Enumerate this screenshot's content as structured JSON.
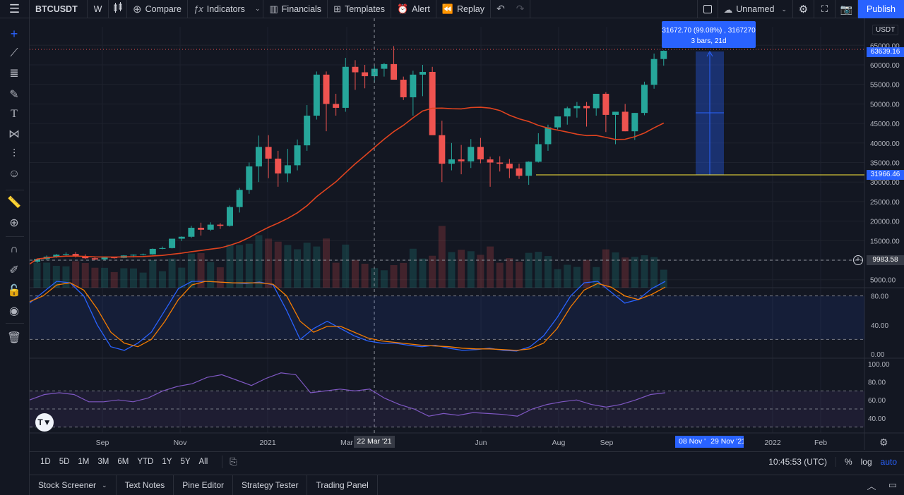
{
  "toolbar": {
    "symbol": "BTCUSDT",
    "interval": "W",
    "compare": "Compare",
    "indicators": "Indicators",
    "financials": "Financials",
    "templates": "Templates",
    "alert": "Alert",
    "replay": "Replay",
    "layout_name": "Unnamed",
    "publish": "Publish"
  },
  "price_axis": {
    "currency": "USDT",
    "ticks": [
      "65000.00",
      "60000.00",
      "55000.00",
      "50000.00",
      "45000.00",
      "40000.00",
      "35000.00",
      "30000.00",
      "25000.00",
      "20000.00",
      "15000.00",
      "10000.00",
      "5000.00"
    ],
    "last_price": "63639.16",
    "horizontal_line_price": "31966.46",
    "crosshair_price": "9983.58"
  },
  "measure_tooltip": {
    "line1": "31672.70 (99.08%) , 3167270",
    "line2": "3 bars, 21d"
  },
  "oscillator1_ticks": [
    "80.00",
    "40.00",
    "0.00"
  ],
  "oscillator2_ticks": [
    "100.00",
    "80.00",
    "60.00",
    "40.00"
  ],
  "time_axis": {
    "labels": [
      "Sep",
      "Nov",
      "2021",
      "Mar",
      "Jun",
      "Aug",
      "Sep",
      "2022",
      "Feb"
    ],
    "crosshair_date": "22 Mar '21",
    "range_start": "08 Nov '",
    "range_end": "29 Nov '21"
  },
  "timeframes": [
    "1D",
    "5D",
    "1M",
    "3M",
    "6M",
    "YTD",
    "1Y",
    "5Y",
    "All"
  ],
  "clock": "10:45:53 (UTC)",
  "scale_options": [
    "%",
    "log",
    "auto"
  ],
  "bottom_tabs": [
    "Stock Screener",
    "Text Notes",
    "Pine Editor",
    "Strategy Tester",
    "Trading Panel"
  ],
  "colors": {
    "up": "#26a69a",
    "down": "#ef5350",
    "ma": "#e0431f",
    "stoch_k": "#2962ff",
    "stoch_d": "#f57c00",
    "rsi": "#7e57c2",
    "accent": "#2962ff",
    "hline": "#ffeb3b"
  },
  "chart_data": {
    "type": "candlestick",
    "candles": [
      {
        "o": 9600,
        "h": 10400,
        "l": 9300,
        "c": 10300
      },
      {
        "o": 10300,
        "h": 11200,
        "l": 10000,
        "c": 10900
      },
      {
        "o": 10900,
        "h": 11600,
        "l": 10600,
        "c": 11400
      },
      {
        "o": 11400,
        "h": 12000,
        "l": 11000,
        "c": 11600
      },
      {
        "o": 11600,
        "h": 12100,
        "l": 10700,
        "c": 11000
      },
      {
        "o": 11000,
        "h": 11500,
        "l": 10300,
        "c": 10500
      },
      {
        "o": 10500,
        "h": 10800,
        "l": 10000,
        "c": 10200
      },
      {
        "o": 10200,
        "h": 10900,
        "l": 10100,
        "c": 10700
      },
      {
        "o": 10700,
        "h": 10900,
        "l": 10400,
        "c": 10600
      },
      {
        "o": 10600,
        "h": 11300,
        "l": 10500,
        "c": 11200
      },
      {
        "o": 11200,
        "h": 11500,
        "l": 10700,
        "c": 11400
      },
      {
        "o": 11400,
        "h": 11700,
        "l": 11200,
        "c": 11500
      },
      {
        "o": 11500,
        "h": 13000,
        "l": 11400,
        "c": 12900
      },
      {
        "o": 12900,
        "h": 13500,
        "l": 12800,
        "c": 13100
      },
      {
        "o": 13100,
        "h": 15000,
        "l": 13000,
        "c": 15500
      },
      {
        "o": 15500,
        "h": 16100,
        "l": 14900,
        "c": 16000
      },
      {
        "o": 16000,
        "h": 18800,
        "l": 15700,
        "c": 18300
      },
      {
        "o": 18300,
        "h": 19600,
        "l": 16300,
        "c": 17800
      },
      {
        "o": 17800,
        "h": 19700,
        "l": 17500,
        "c": 19100
      },
      {
        "o": 19100,
        "h": 19500,
        "l": 18000,
        "c": 18800
      },
      {
        "o": 18800,
        "h": 24000,
        "l": 18600,
        "c": 23600
      },
      {
        "o": 23600,
        "h": 28500,
        "l": 22200,
        "c": 28000
      },
      {
        "o": 28000,
        "h": 35000,
        "l": 27000,
        "c": 34000
      },
      {
        "o": 34000,
        "h": 41900,
        "l": 30000,
        "c": 39000
      },
      {
        "o": 39000,
        "h": 42000,
        "l": 31000,
        "c": 36000
      },
      {
        "o": 36000,
        "h": 38000,
        "l": 28800,
        "c": 32200
      },
      {
        "o": 32200,
        "h": 38500,
        "l": 30000,
        "c": 34300
      },
      {
        "o": 34300,
        "h": 40900,
        "l": 33000,
        "c": 39400
      },
      {
        "o": 39400,
        "h": 49700,
        "l": 38000,
        "c": 47000
      },
      {
        "o": 47000,
        "h": 58300,
        "l": 46000,
        "c": 57500
      },
      {
        "o": 57500,
        "h": 58300,
        "l": 43000,
        "c": 50000
      },
      {
        "o": 50000,
        "h": 52600,
        "l": 47000,
        "c": 49000
      },
      {
        "o": 49000,
        "h": 61800,
        "l": 48000,
        "c": 59500
      },
      {
        "o": 59500,
        "h": 61200,
        "l": 53600,
        "c": 58100
      },
      {
        "o": 58100,
        "h": 60000,
        "l": 54000,
        "c": 57100
      },
      {
        "o": 57100,
        "h": 59800,
        "l": 55500,
        "c": 59000
      },
      {
        "o": 59000,
        "h": 60500,
        "l": 57000,
        "c": 60200
      },
      {
        "o": 60200,
        "h": 64800,
        "l": 58900,
        "c": 56200
      },
      {
        "o": 56200,
        "h": 57000,
        "l": 51000,
        "c": 51700
      },
      {
        "o": 51700,
        "h": 58500,
        "l": 47000,
        "c": 57500
      },
      {
        "o": 57500,
        "h": 60000,
        "l": 52000,
        "c": 58200
      },
      {
        "o": 58200,
        "h": 59500,
        "l": 50500,
        "c": 42000
      },
      {
        "o": 42000,
        "h": 45700,
        "l": 30000,
        "c": 34700
      },
      {
        "o": 34700,
        "h": 40000,
        "l": 33000,
        "c": 35800
      },
      {
        "o": 35800,
        "h": 39500,
        "l": 32000,
        "c": 35300
      },
      {
        "o": 35300,
        "h": 41000,
        "l": 33600,
        "c": 39000
      },
      {
        "o": 39000,
        "h": 41300,
        "l": 34800,
        "c": 35800
      },
      {
        "o": 35800,
        "h": 36500,
        "l": 28800,
        "c": 35000
      },
      {
        "o": 35000,
        "h": 36600,
        "l": 32700,
        "c": 34700
      },
      {
        "o": 34700,
        "h": 35900,
        "l": 31000,
        "c": 33500
      },
      {
        "o": 33500,
        "h": 34700,
        "l": 30800,
        "c": 31600
      },
      {
        "o": 31600,
        "h": 35300,
        "l": 29300,
        "c": 35200
      },
      {
        "o": 35200,
        "h": 42500,
        "l": 35000,
        "c": 39700
      },
      {
        "o": 39700,
        "h": 44700,
        "l": 38000,
        "c": 44000
      },
      {
        "o": 44000,
        "h": 46500,
        "l": 43500,
        "c": 46800
      },
      {
        "o": 46800,
        "h": 49300,
        "l": 44700,
        "c": 48900
      },
      {
        "o": 48900,
        "h": 50500,
        "l": 46500,
        "c": 49500
      },
      {
        "o": 49500,
        "h": 50500,
        "l": 44200,
        "c": 48900
      },
      {
        "o": 48900,
        "h": 51000,
        "l": 47000,
        "c": 52600
      },
      {
        "o": 52600,
        "h": 53000,
        "l": 42800,
        "c": 47200
      },
      {
        "o": 47200,
        "h": 48000,
        "l": 39700,
        "c": 48000
      },
      {
        "o": 48000,
        "h": 50000,
        "l": 43000,
        "c": 43000
      },
      {
        "o": 43000,
        "h": 47700,
        "l": 40800,
        "c": 47700
      },
      {
        "o": 47700,
        "h": 55700,
        "l": 47100,
        "c": 54900
      },
      {
        "o": 54900,
        "h": 62900,
        "l": 53900,
        "c": 61500
      },
      {
        "o": 61500,
        "h": 63700,
        "l": 59800,
        "c": 63600
      }
    ]
  }
}
